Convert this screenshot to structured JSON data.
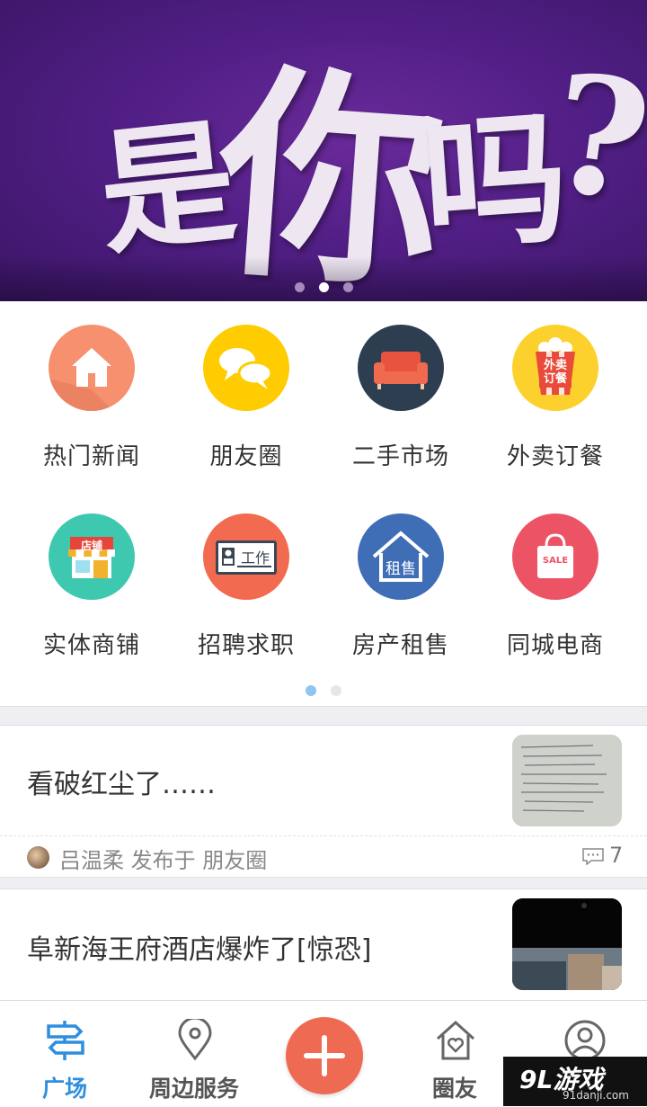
{
  "banner": {
    "chars": [
      "是",
      "你",
      "吗",
      "?"
    ],
    "dot_count": 3,
    "active_dot": 1
  },
  "categories": [
    {
      "label": "热门新闻",
      "icon": "house-icon",
      "color": "#f6906f"
    },
    {
      "label": "朋友圈",
      "icon": "chat-bubbles-icon",
      "color": "#fecc00"
    },
    {
      "label": "二手市场",
      "icon": "sofa-icon",
      "color": "#2c3e50"
    },
    {
      "label": "外卖订餐",
      "icon": "takeout-box-icon",
      "color": "#fdd12d",
      "icon_text": [
        "外卖",
        "订餐"
      ]
    },
    {
      "label": "实体商铺",
      "icon": "storefront-icon",
      "color": "#3fc8b0",
      "icon_text": [
        "店铺"
      ]
    },
    {
      "label": "招聘求职",
      "icon": "work-card-icon",
      "color": "#f26a50",
      "icon_text": [
        "工作"
      ]
    },
    {
      "label": "房产租售",
      "icon": "house-rent-icon",
      "color": "#3f6db6",
      "icon_text": [
        "租售"
      ]
    },
    {
      "label": "同城电商",
      "icon": "shopping-bag-icon",
      "color": "#ec5466",
      "icon_text": [
        "SALE"
      ]
    }
  ],
  "grid_pager": {
    "count": 2,
    "active": 0
  },
  "posts": [
    {
      "title": "看破红尘了……",
      "author_line": "吕温柔 发布于 朋友圈",
      "comments": "7",
      "thumb": "handwritten-note-photo"
    },
    {
      "title": "阜新海王府酒店爆炸了[惊恐]",
      "thumb": "street-scene-photo"
    }
  ],
  "nav": {
    "items": [
      {
        "label": "广场",
        "icon": "signpost-icon",
        "active": true
      },
      {
        "label": "周边服务",
        "icon": "location-pin-icon",
        "active": false
      },
      {
        "label": "",
        "icon": "plus-icon",
        "active": false
      },
      {
        "label": "圈友",
        "icon": "heart-house-icon",
        "active": false
      },
      {
        "label": "",
        "icon": "user-icon",
        "active": false
      }
    ]
  },
  "watermark": {
    "main": "9L游戏",
    "sub": "91danji.com"
  },
  "colors": {
    "accent": "#2e8ee0",
    "fab": "#ef6a52",
    "banner": "#521f86"
  }
}
